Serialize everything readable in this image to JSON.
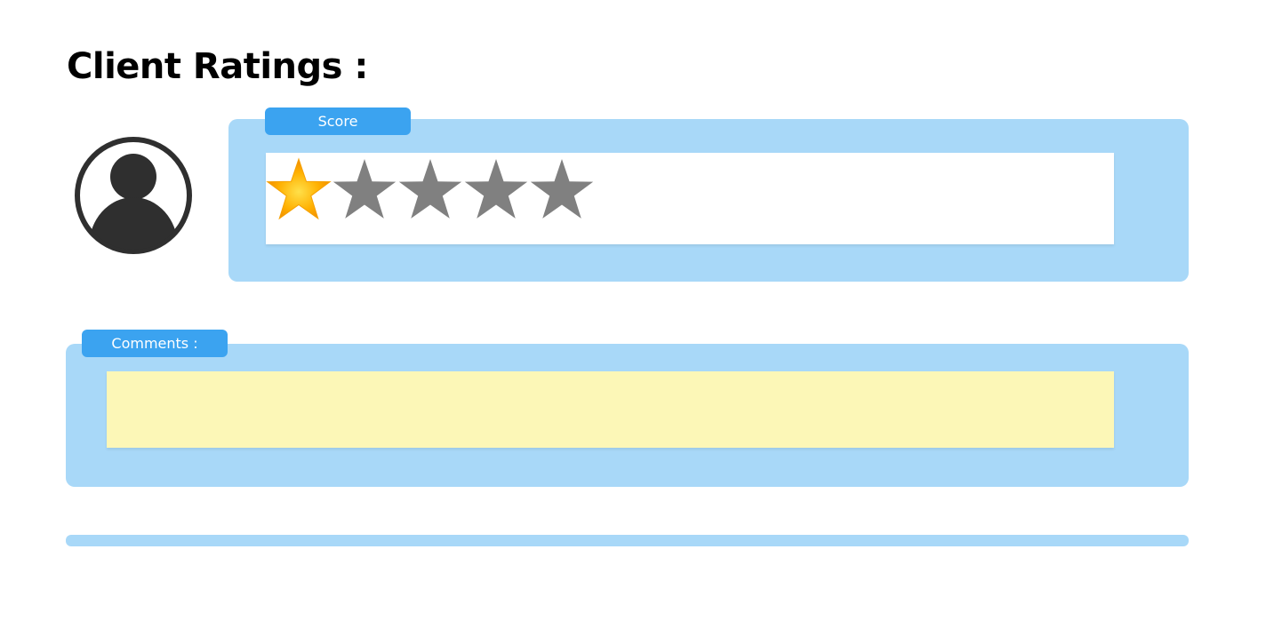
{
  "header": {
    "title": "Client Ratings :"
  },
  "avatar": {
    "icon": "user-avatar-icon"
  },
  "score": {
    "label": "Score",
    "rating": 1,
    "max": 5,
    "filled_icon": "star-filled-icon",
    "empty_icon": "star-empty-icon"
  },
  "comments": {
    "label": "Comments :",
    "value": "",
    "placeholder": ""
  },
  "colors": {
    "panel": "#a8d8f8",
    "tag": "#3ba3f0",
    "comment_box": "#fcf7b7",
    "star_filled": "#ffb000",
    "star_empty": "#808080"
  }
}
